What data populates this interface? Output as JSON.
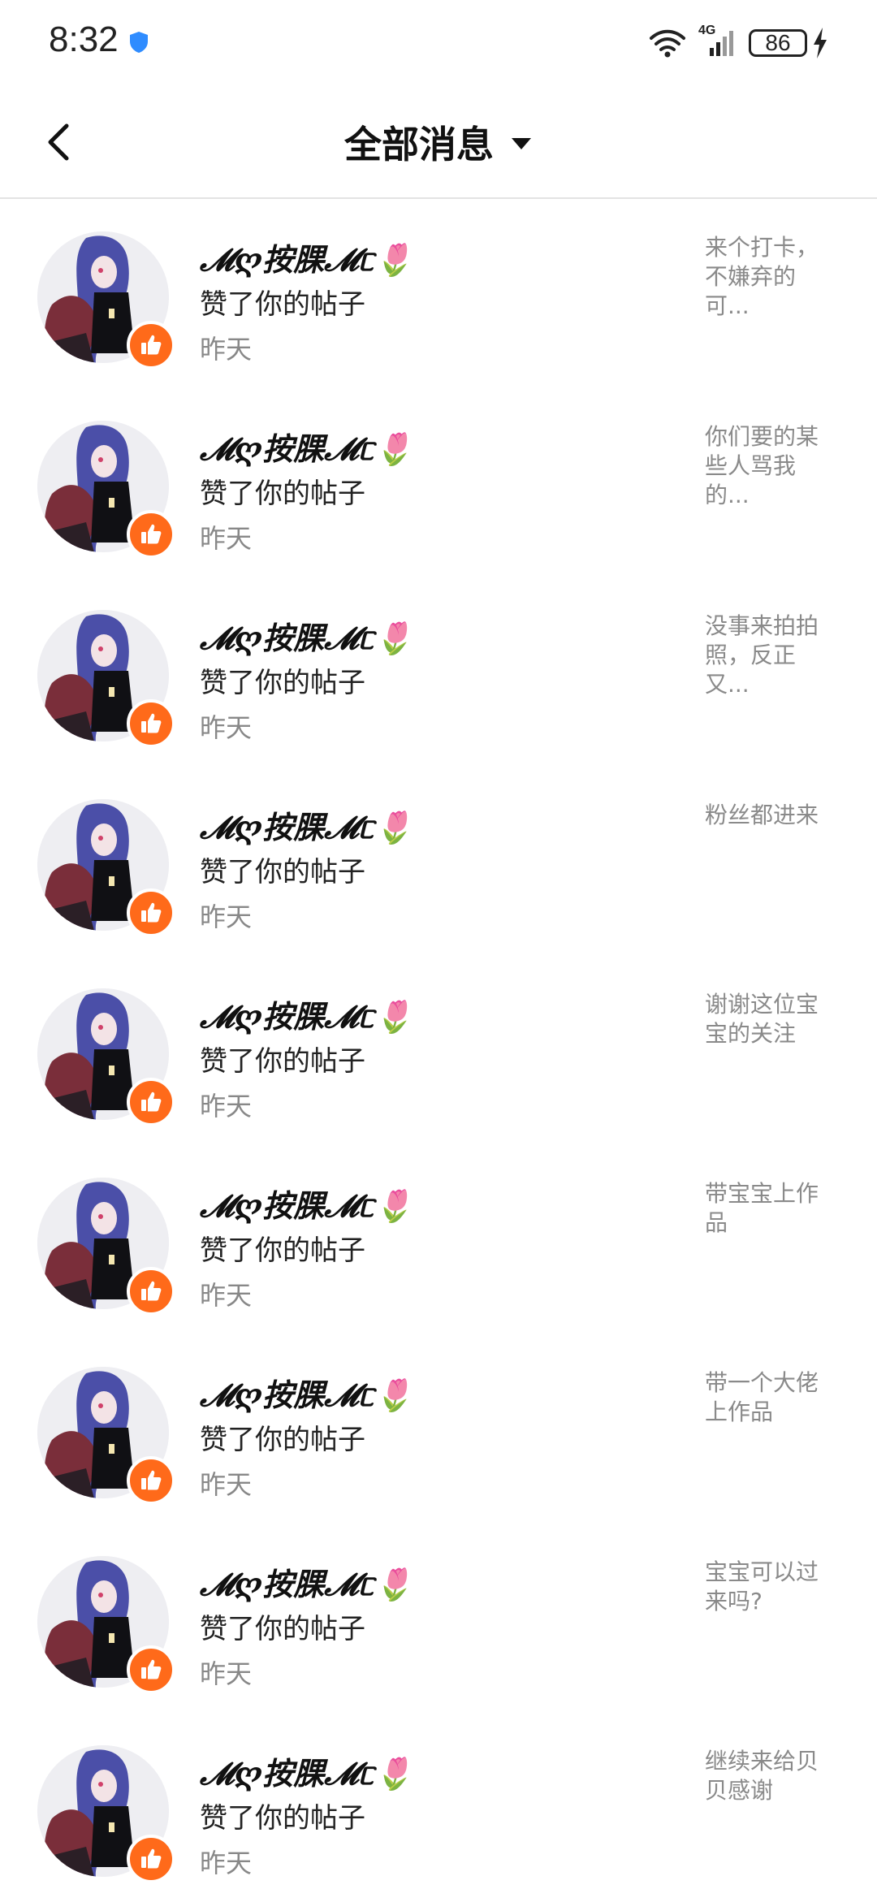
{
  "status_bar": {
    "time": "8:32",
    "network": "4G",
    "battery": "86"
  },
  "header": {
    "title": "全部消息"
  },
  "notifications": [
    {
      "name": "𝓜ღ按腂𝓜ᥴ🌷",
      "action": "赞了你的帖子",
      "time": "昨天",
      "preview": "来个打卡，不嫌弃的可..."
    },
    {
      "name": "𝓜ღ按腂𝓜ᥴ🌷",
      "action": "赞了你的帖子",
      "time": "昨天",
      "preview": "你们要的某些人骂我的..."
    },
    {
      "name": "𝓜ღ按腂𝓜ᥴ🌷",
      "action": "赞了你的帖子",
      "time": "昨天",
      "preview": "没事来拍拍照，反正又..."
    },
    {
      "name": "𝓜ღ按腂𝓜ᥴ🌷",
      "action": "赞了你的帖子",
      "time": "昨天",
      "preview": "粉丝都进来"
    },
    {
      "name": "𝓜ღ按腂𝓜ᥴ🌷",
      "action": "赞了你的帖子",
      "time": "昨天",
      "preview": "谢谢这位宝宝的关注"
    },
    {
      "name": "𝓜ღ按腂𝓜ᥴ🌷",
      "action": "赞了你的帖子",
      "time": "昨天",
      "preview": "带宝宝上作品"
    },
    {
      "name": "𝓜ღ按腂𝓜ᥴ🌷",
      "action": "赞了你的帖子",
      "time": "昨天",
      "preview": "带一个大佬上作品"
    },
    {
      "name": "𝓜ღ按腂𝓜ᥴ🌷",
      "action": "赞了你的帖子",
      "time": "昨天",
      "preview": "宝宝可以过来吗?"
    },
    {
      "name": "𝓜ღ按腂𝓜ᥴ🌷",
      "action": "赞了你的帖子",
      "time": "昨天",
      "preview": "继续来给贝贝感谢"
    }
  ],
  "icons": {
    "back": "back-arrow-icon",
    "dropdown": "caret-down-icon",
    "badge": "thumbs-up-icon",
    "status": [
      "shield-icon",
      "wifi-icon",
      "signal-icon",
      "battery-icon",
      "charging-bolt-icon"
    ]
  },
  "colors": {
    "like_badge": "#ff6a1a",
    "preview_text": "#8a8a8a",
    "time_text": "#888888",
    "shield": "#2f8cff"
  }
}
